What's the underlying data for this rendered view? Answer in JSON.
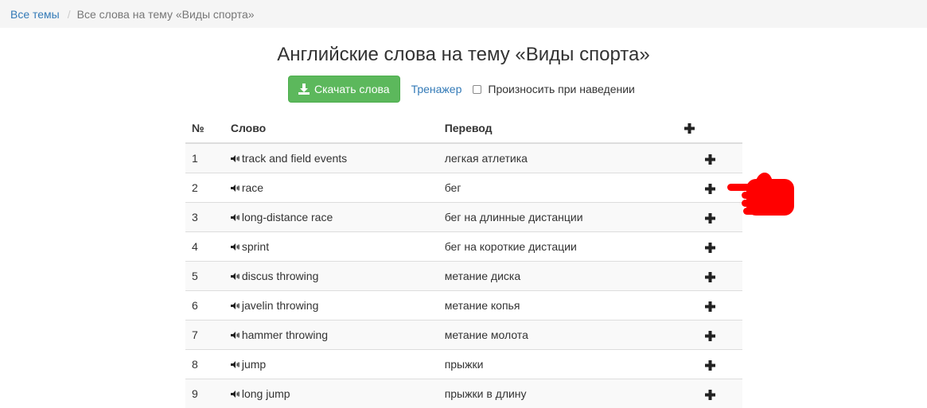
{
  "breadcrumb": {
    "all_topics": "Все темы",
    "separator": "/",
    "current": "Все слова на тему «Виды спорта»"
  },
  "page_title": "Английские слова на тему «Виды спорта»",
  "toolbar": {
    "download_label": "Скачать слова",
    "trainer_label": "Тренажер",
    "pronounce_label": "Произносить при наведении",
    "pronounce_checked": false
  },
  "table": {
    "headers": {
      "num": "№",
      "word": "Слово",
      "translation": "Перевод"
    },
    "rows": [
      {
        "num": "1",
        "word": "track and field events",
        "translation": "легкая атлетика"
      },
      {
        "num": "2",
        "word": "race",
        "translation": "бег"
      },
      {
        "num": "3",
        "word": "long-distance race",
        "translation": "бег на длинные дистанции"
      },
      {
        "num": "4",
        "word": "sprint",
        "translation": "бег на короткие дистации"
      },
      {
        "num": "5",
        "word": "discus throwing",
        "translation": "метание диска"
      },
      {
        "num": "6",
        "word": "javelin throwing",
        "translation": "метание копья"
      },
      {
        "num": "7",
        "word": "hammer throwing",
        "translation": "метание молота"
      },
      {
        "num": "8",
        "word": "jump",
        "translation": "прыжки"
      },
      {
        "num": "9",
        "word": "long jump",
        "translation": "прыжки в длину"
      }
    ]
  },
  "icons": {
    "download": "download-icon",
    "speaker": "speaker-icon",
    "add": "plus-icon",
    "pointer": "pointing-hand-icon"
  },
  "colors": {
    "link": "#337ab7",
    "button_green": "#5cb85c",
    "breadcrumb_bg": "#f5f5f5",
    "pointer_red": "#ff0000"
  }
}
